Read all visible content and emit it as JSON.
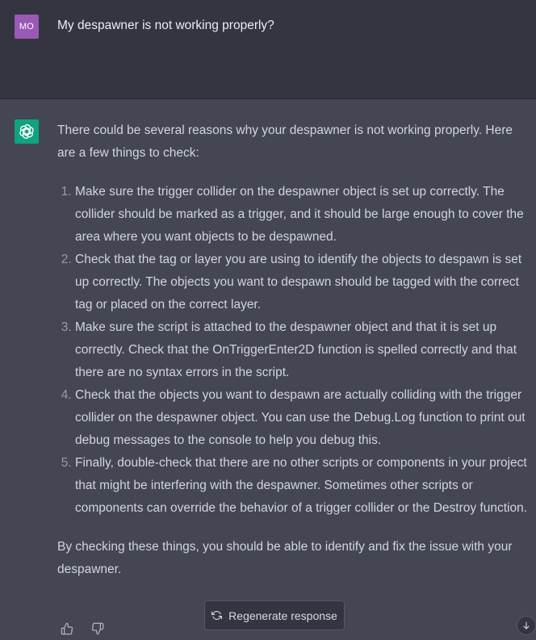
{
  "user": {
    "avatar_initials": "MO",
    "message": "My despawner is not working properly?"
  },
  "assistant": {
    "intro": "There could be several reasons why your despawner is not working properly. Here are a few things to check:",
    "items": [
      {
        "text": "Make sure the trigger collider on the despawner object is set up correctly. The collider should be marked as a trigger, and it should be large enough to cover the area where you want objects to be despawned."
      },
      {
        "text": "Check that the tag or layer you are using to identify the objects to despawn is set up correctly. The objects you want to despawn should be tagged with the correct tag or placed on the correct layer."
      },
      {
        "text": "Make sure the script is attached to the despawner object and that it is set up correctly. Check that the OnTriggerEnter2D function is spelled correctly and that there are no syntax errors in the script."
      },
      {
        "text": "Check that the objects you want to despawn are actually colliding with the trigger collider on the despawner object. You can use the Debug.Log function to print out debug messages to the console to help you debug this."
      },
      {
        "text": "Finally, double-check that there are no other scripts or components in your project that might be interfering with the despawner. Sometimes other scripts or components can override the behavior of a trigger collider or the Destroy function."
      }
    ],
    "outro": "By checking these things, you should be able to identify and fix the issue with your despawner."
  },
  "controls": {
    "regenerate_label": "Regenerate response",
    "regenerate_icon": "refresh-icon",
    "thumbs_up_icon": "thumbs-up-icon",
    "thumbs_down_icon": "thumbs-down-icon",
    "scroll_down_icon": "arrow-down-icon"
  },
  "colors": {
    "user_bg": "#343541",
    "assistant_bg": "#444654",
    "user_avatar": "#9b59b6",
    "assistant_avatar": "#10a37f"
  }
}
